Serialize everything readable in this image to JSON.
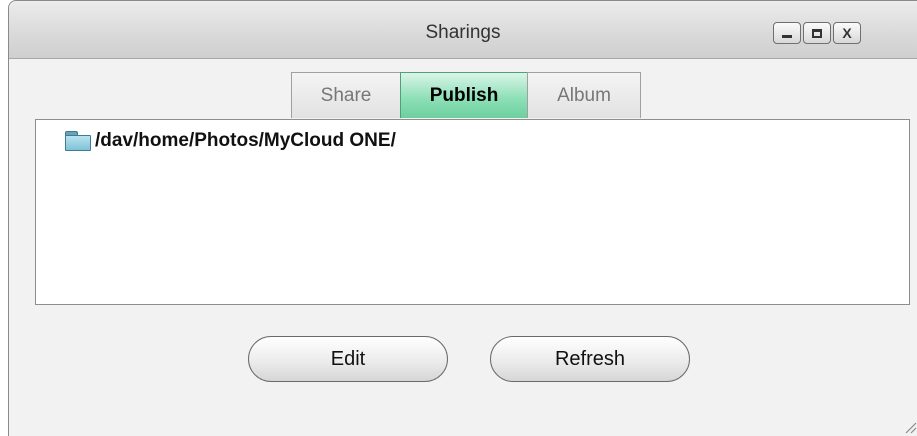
{
  "window": {
    "title": "Sharings",
    "controls": [
      "minimize-icon",
      "maximize-icon",
      "close-icon"
    ],
    "close_glyph": "X"
  },
  "tabs": [
    {
      "label": "Share",
      "active": false
    },
    {
      "label": "Publish",
      "active": true
    },
    {
      "label": "Album",
      "active": false
    }
  ],
  "list": {
    "items": [
      {
        "icon": "folder-icon",
        "path": "/dav/home/Photos/MyCloud ONE/"
      }
    ]
  },
  "buttons": {
    "edit": "Edit",
    "refresh": "Refresh"
  },
  "colors": {
    "active_tab": "#8fe0b8",
    "window_bg": "#f2f2f2"
  }
}
